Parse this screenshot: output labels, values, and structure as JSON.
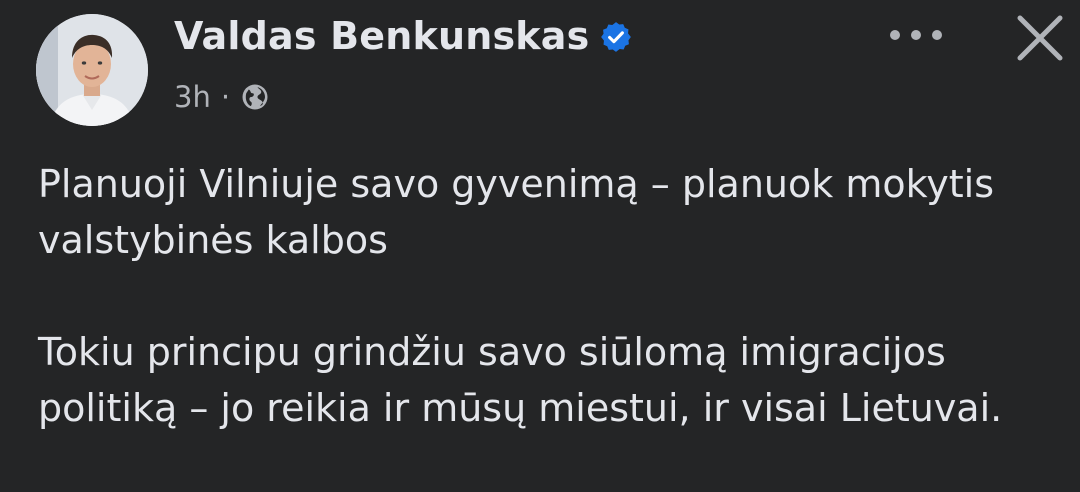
{
  "post": {
    "author_name": "Valdas Benkunskas",
    "timestamp": "3h",
    "separator": "·",
    "verified": true,
    "privacy_icon": "globe-icon",
    "paragraphs": [
      "Planuoji Vilniuje savo gyvenimą – planuok mokytis valstybinės kalbos",
      "Tokiu principu grindžiu savo siūlomą imigracijos politiką – jo reikia ir mūsų miestui, ir visai Lietuvai."
    ]
  },
  "actions": {
    "more_icon": "more-horizontal-icon",
    "close_icon": "close-icon"
  },
  "colors": {
    "background": "#242526",
    "text_primary": "#e4e6eb",
    "text_secondary": "#b0b3b8",
    "verified_blue": "#1b74e4"
  }
}
